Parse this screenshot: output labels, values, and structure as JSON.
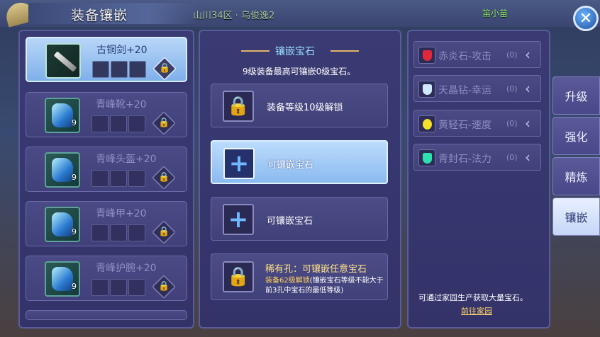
{
  "header": {
    "title": "装备镶嵌",
    "server": "山川34区 · 乌俊逸2",
    "player": "笛小苗"
  },
  "items": [
    {
      "name": "古铜剑+20",
      "level": "",
      "selected": true
    },
    {
      "name": "青峰靴+20",
      "level": "9"
    },
    {
      "name": "青峰头盔+20",
      "level": "9"
    },
    {
      "name": "青峰甲+20",
      "level": "9"
    },
    {
      "name": "青峰护腕+20",
      "level": "9"
    }
  ],
  "inlay": {
    "title": "镶嵌宝石",
    "subtitle": "9级装备最高可镶嵌0级宝石。",
    "slots": [
      {
        "label": "装备等级10级解锁"
      },
      {
        "label": "可镶嵌宝石"
      },
      {
        "label": "可镶嵌宝石"
      }
    ],
    "rare": {
      "title": "稀有孔：可镶嵌任意宝石",
      "req": "装备62级解锁",
      "note": "(镶嵌宝石等级不能大于前3孔中宝石的最低等级)"
    }
  },
  "gems": [
    {
      "name": "赤炎石-攻击",
      "count": "(0)",
      "color": "#e0283c"
    },
    {
      "name": "天晶钻-幸运",
      "count": "(0)",
      "color": "#cfe8ff"
    },
    {
      "name": "黄轻石-速度",
      "count": "(0)",
      "color": "#f4e02a"
    },
    {
      "name": "青封石-法力",
      "count": "(0)",
      "color": "#2ee0b0"
    }
  ],
  "right": {
    "note": "可通过家园生产获取大量宝石。",
    "link": "前往家园"
  },
  "tabs": [
    {
      "label": "升级"
    },
    {
      "label": "强化"
    },
    {
      "label": "精炼"
    },
    {
      "label": "镶嵌",
      "active": true
    }
  ]
}
